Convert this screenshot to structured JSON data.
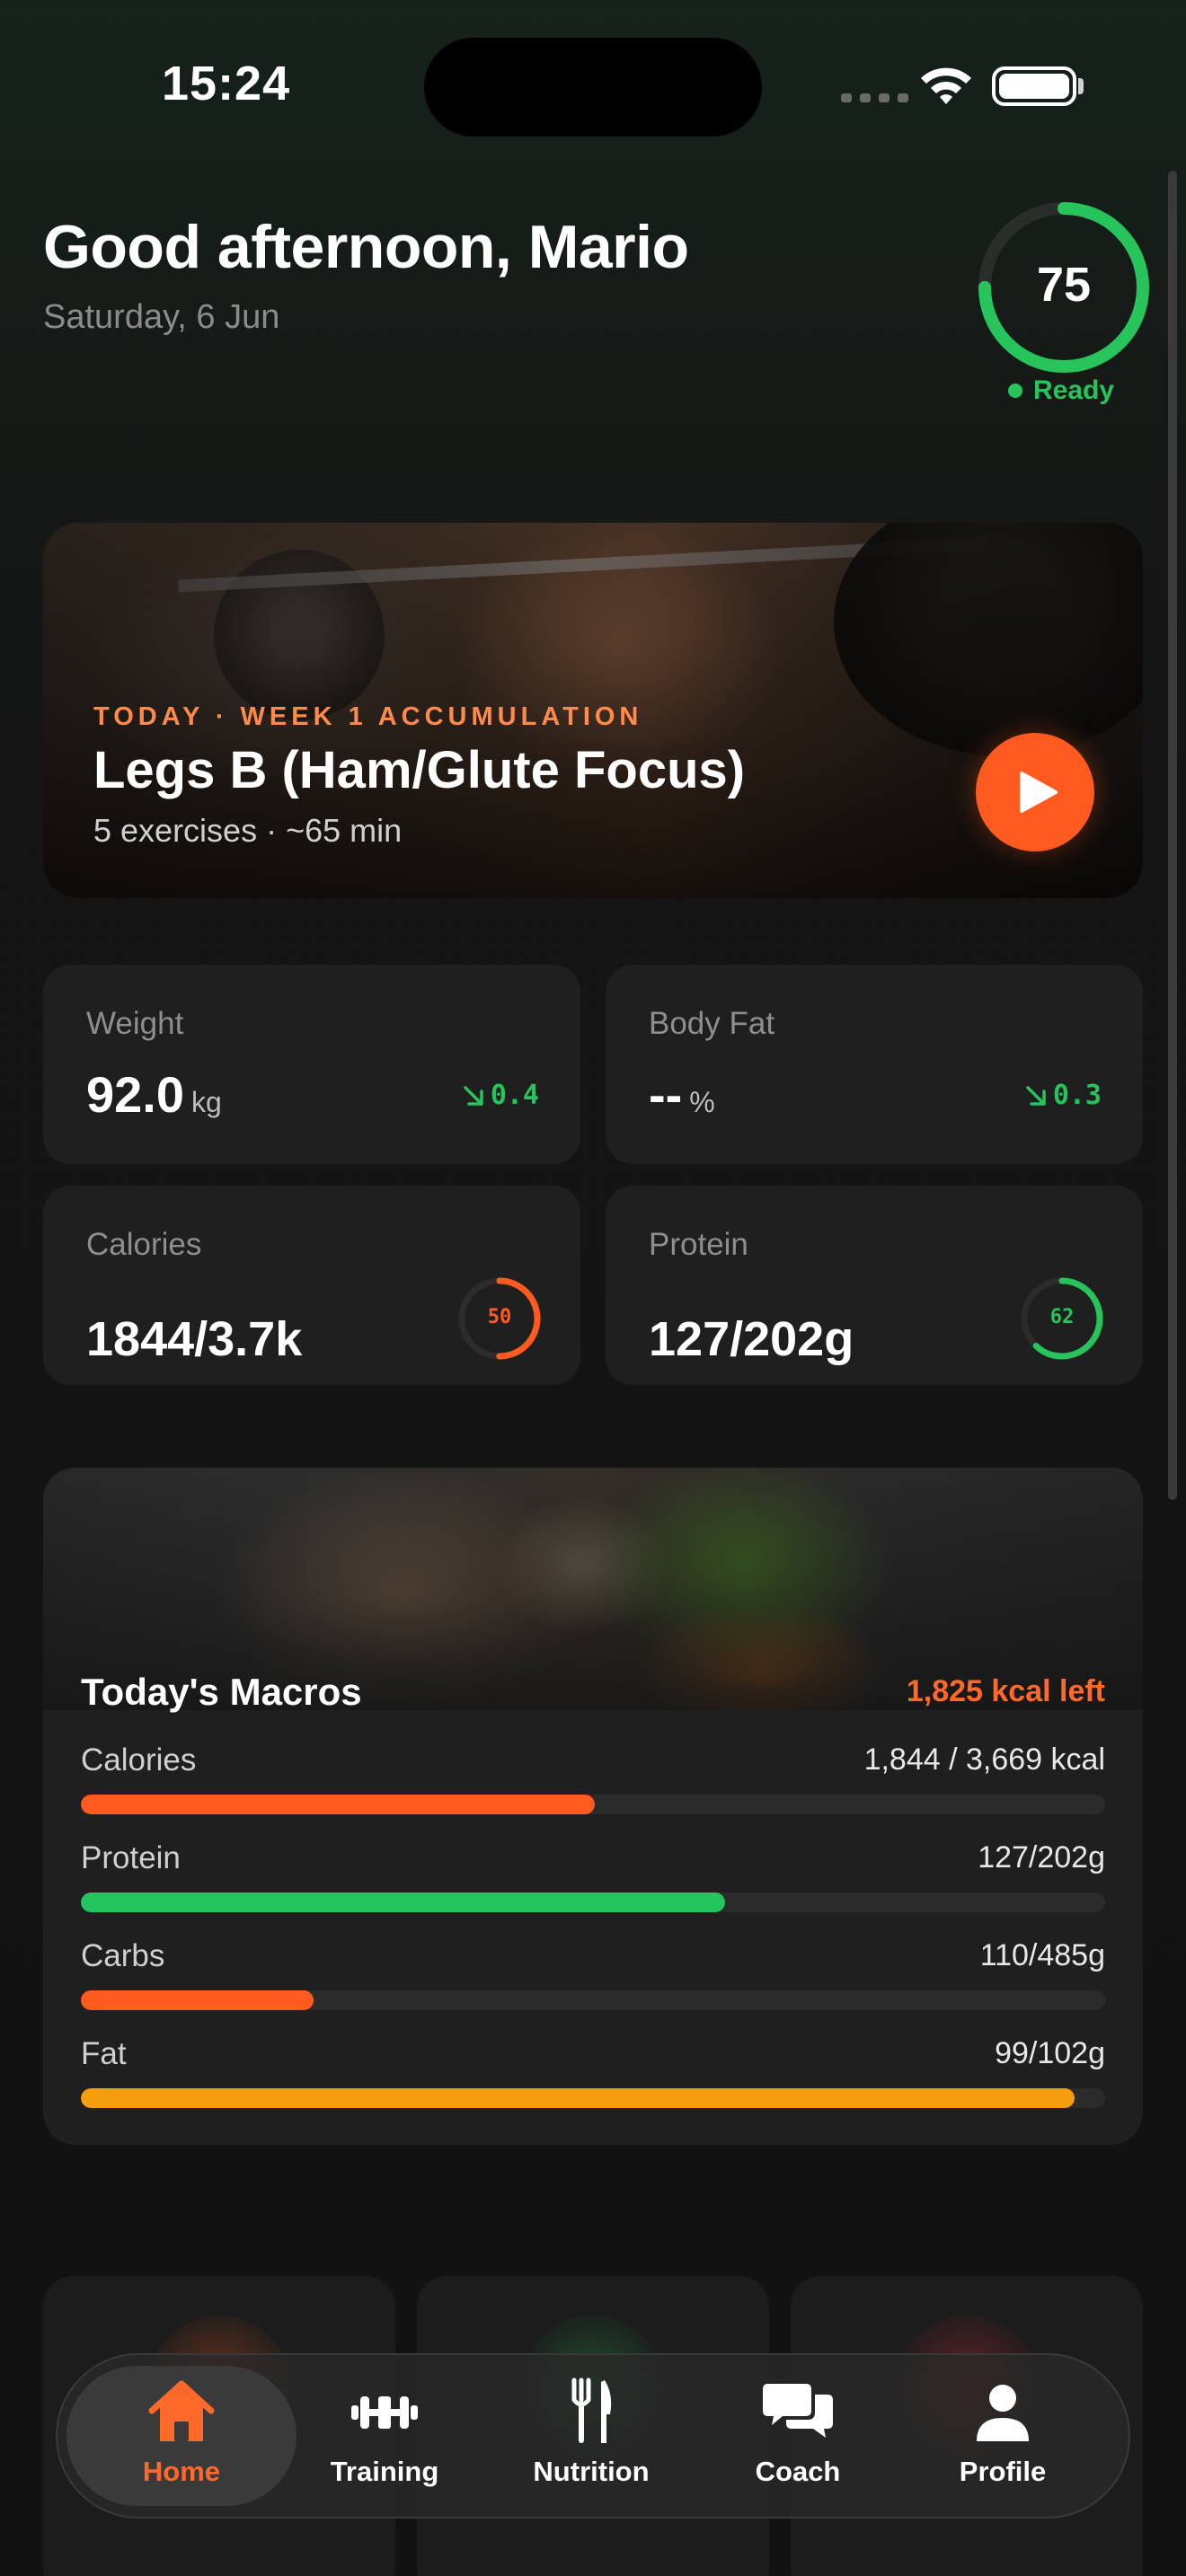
{
  "status_bar": {
    "time": "15:24"
  },
  "header": {
    "greeting": "Good afternoon, Mario",
    "date": "Saturday, 6 Jun",
    "readiness": {
      "score": "75",
      "label": "Ready",
      "progress": 0.75,
      "color": "#27c45c"
    }
  },
  "workout": {
    "kicker": "TODAY · WEEK 1 ACCUMULATION",
    "title": "Legs B (Ham/Glute Focus)",
    "subtitle": "5 exercises · ~65 min",
    "icon": "play-icon",
    "accent": "#ff5a1f"
  },
  "stats": {
    "weight": {
      "label": "Weight",
      "value": "92.0",
      "unit": "kg",
      "trend": "0.4",
      "trend_icon": "arrow-down-right-icon"
    },
    "body_fat": {
      "label": "Body Fat",
      "value": "--",
      "unit": "%",
      "trend": "0.3",
      "trend_icon": "arrow-down-right-icon"
    },
    "calories": {
      "label": "Calories",
      "value": "1844/3.7k",
      "ring": "50",
      "progress": 0.5,
      "color": "#ff5a1f"
    },
    "protein": {
      "label": "Protein",
      "value": "127/202g",
      "ring": "62",
      "progress": 0.62,
      "color": "#27c45c"
    }
  },
  "macros": {
    "title": "Today's Macros",
    "remaining": "1,825 kcal left",
    "rows": [
      {
        "label": "Calories",
        "value": "1,844 / 3,669 kcal",
        "progress": 0.502,
        "color": "#ff5a1f"
      },
      {
        "label": "Protein",
        "value": "127/202g",
        "progress": 0.629,
        "color": "#22c55e"
      },
      {
        "label": "Carbs",
        "value": "110/485g",
        "progress": 0.227,
        "color": "#ff5a1f"
      },
      {
        "label": "Fat",
        "value": "99/102g",
        "progress": 0.97,
        "color": "#f59e0b"
      }
    ]
  },
  "tabbar": {
    "tabs": [
      {
        "label": "Home",
        "icon": "home-icon",
        "active": true
      },
      {
        "label": "Training",
        "icon": "dumbbell-icon",
        "active": false
      },
      {
        "label": "Nutrition",
        "icon": "fork-knife-icon",
        "active": false
      },
      {
        "label": "Coach",
        "icon": "chat-bubbles-icon",
        "active": false
      },
      {
        "label": "Profile",
        "icon": "person-icon",
        "active": false
      }
    ],
    "active_color": "#ff6a2a"
  }
}
